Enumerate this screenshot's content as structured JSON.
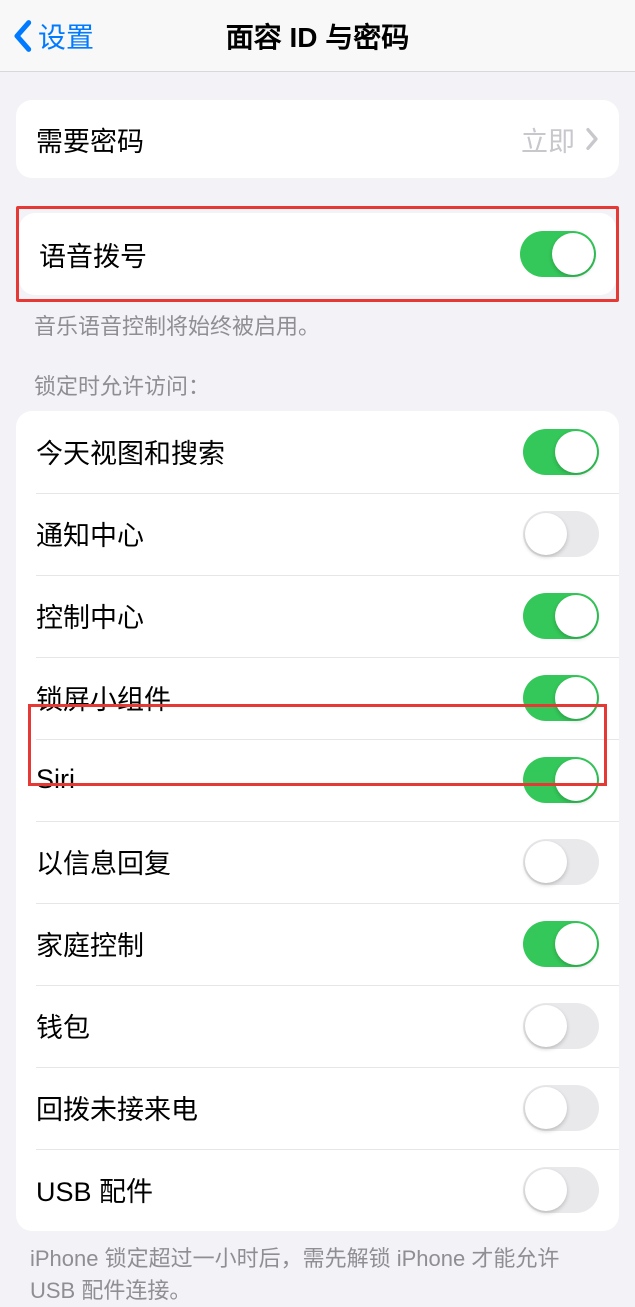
{
  "nav": {
    "back_label": "设置",
    "title": "面容 ID 与密码"
  },
  "passcode": {
    "label": "需要密码",
    "value": "立即"
  },
  "voice_dial": {
    "label": "语音拨号",
    "on": true,
    "footer": "音乐语音控制将始终被启用。"
  },
  "lock_access": {
    "header": "锁定时允许访问：",
    "items": [
      {
        "label": "今天视图和搜索",
        "on": true
      },
      {
        "label": "通知中心",
        "on": false
      },
      {
        "label": "控制中心",
        "on": true
      },
      {
        "label": "锁屏小组件",
        "on": true
      },
      {
        "label": "Siri",
        "on": true
      },
      {
        "label": "以信息回复",
        "on": false
      },
      {
        "label": "家庭控制",
        "on": true
      },
      {
        "label": "钱包",
        "on": false
      },
      {
        "label": "回拨未接来电",
        "on": false
      },
      {
        "label": "USB 配件",
        "on": false
      }
    ],
    "footer": "iPhone 锁定超过一小时后，需先解锁 iPhone 才能允许 USB 配件连接。"
  }
}
